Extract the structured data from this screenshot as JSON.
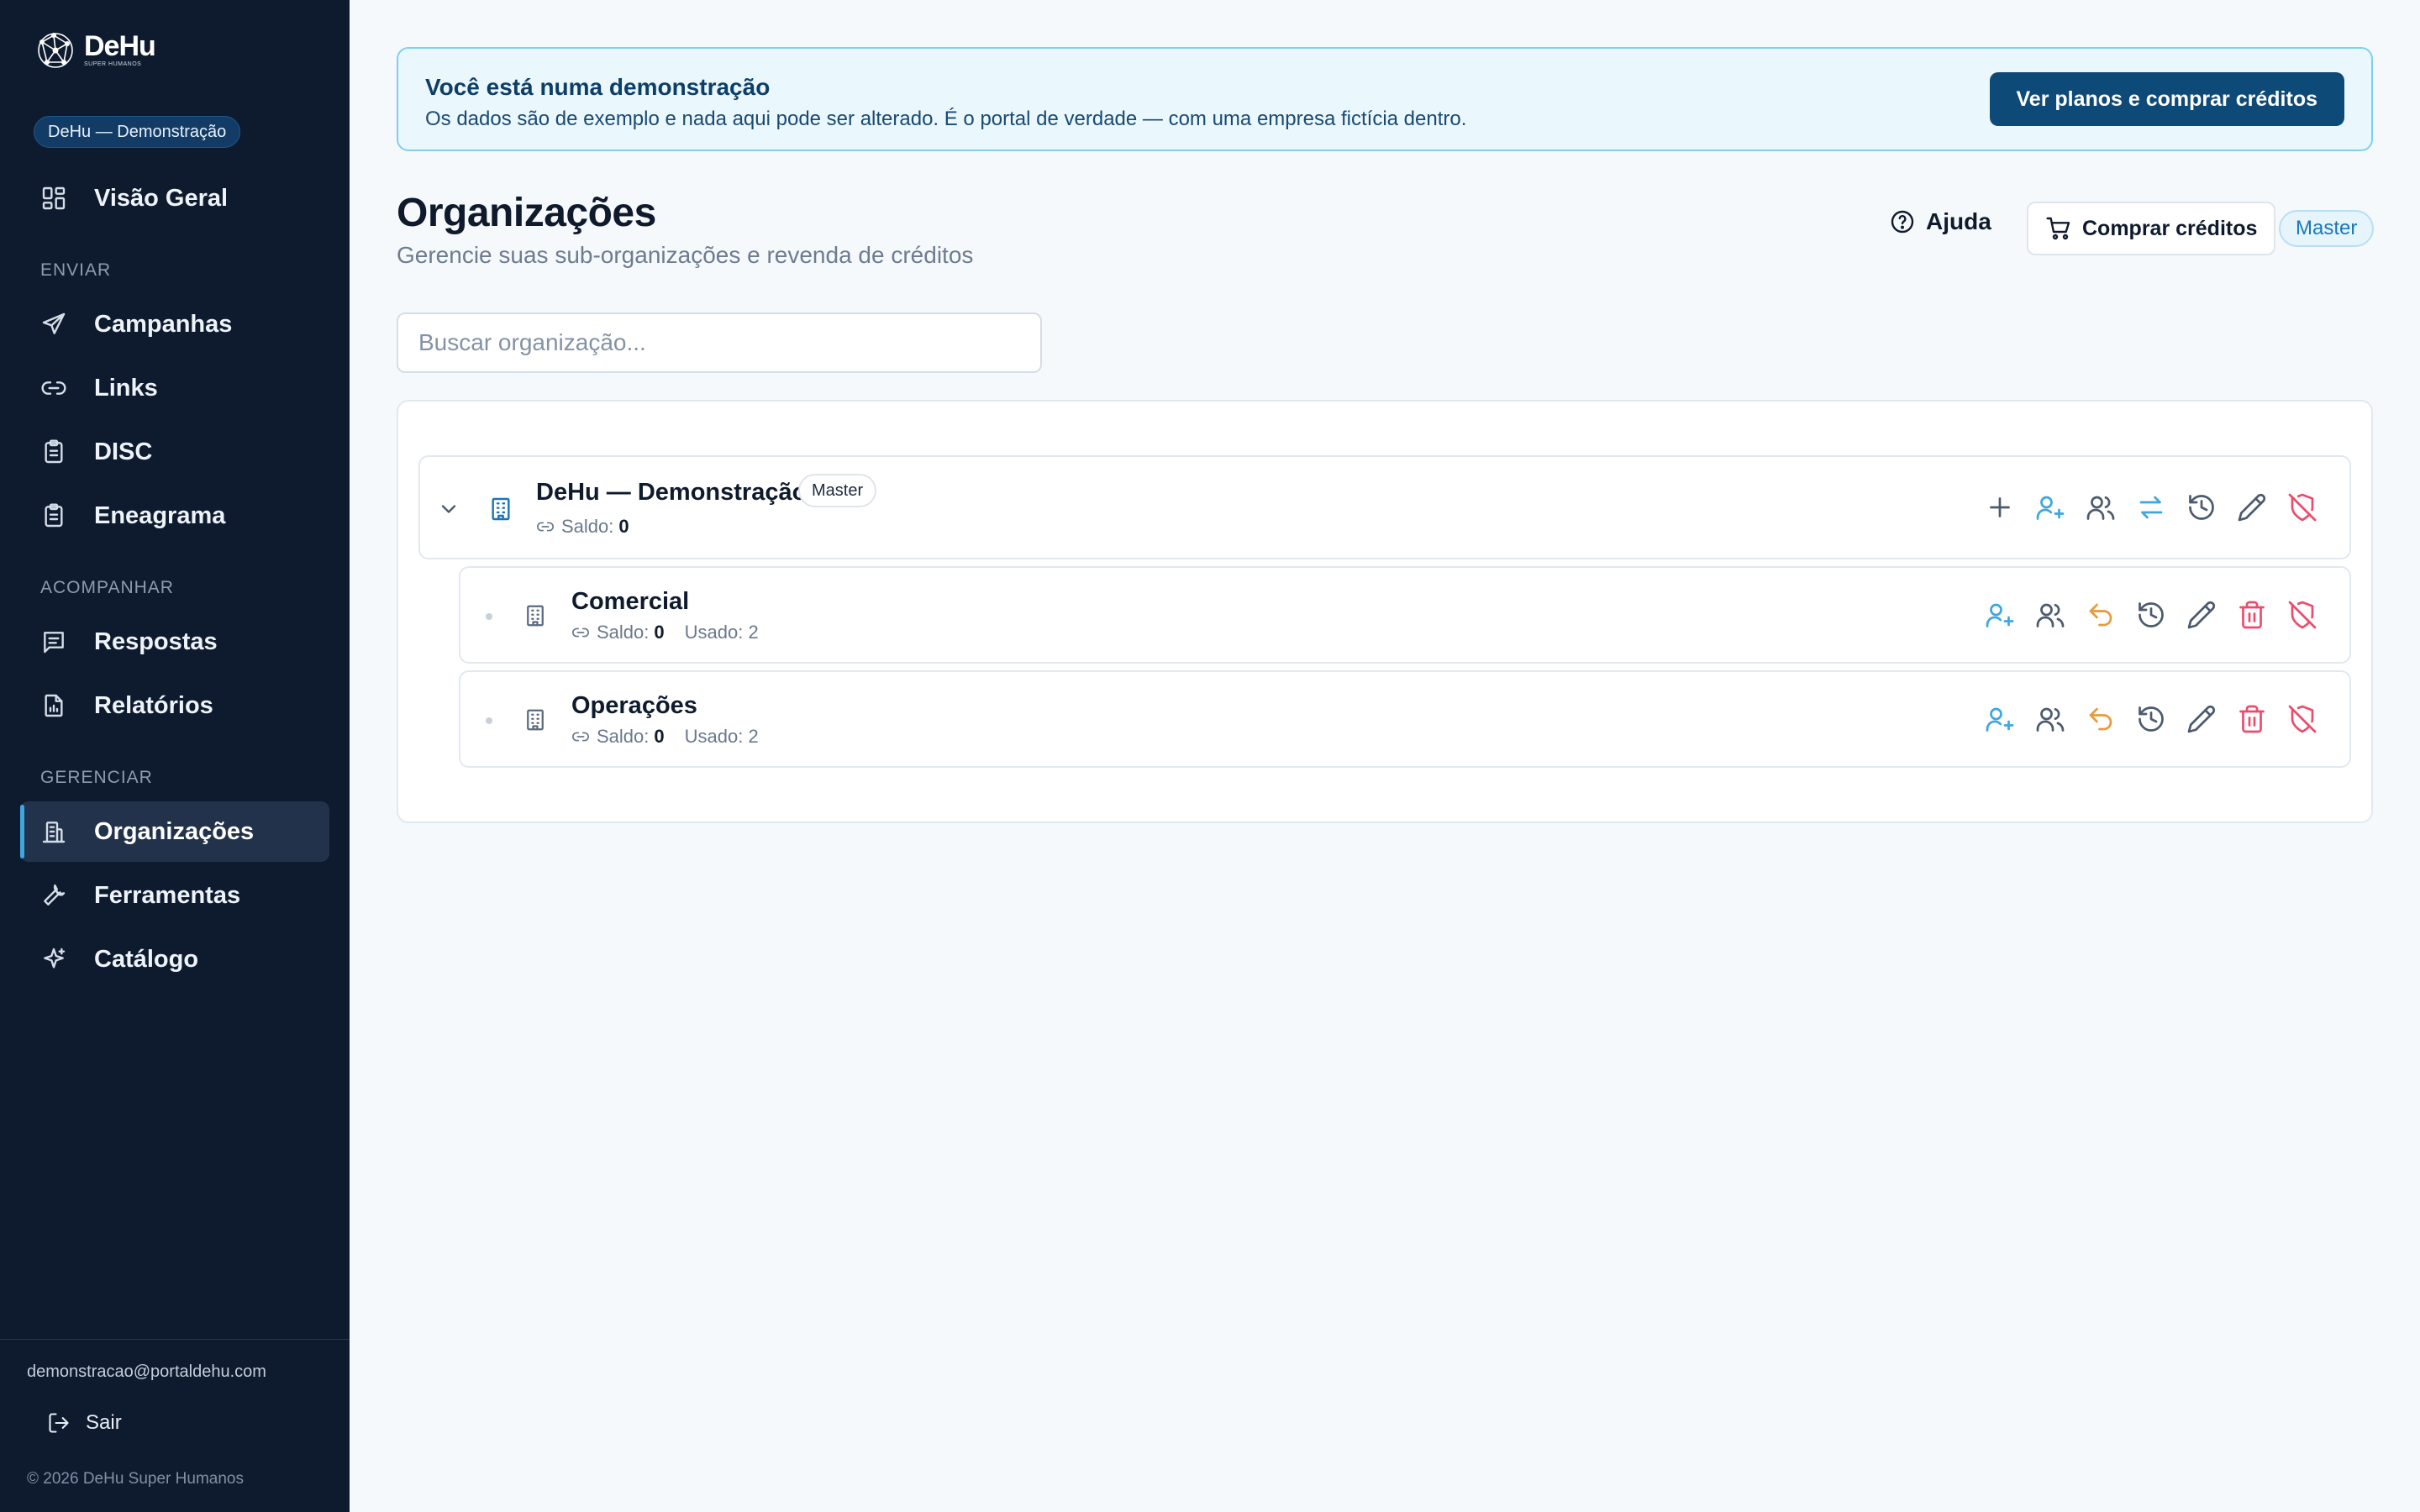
{
  "brand": {
    "name": "DeHu",
    "tagline": "SUPER HUMANOS"
  },
  "sidebar": {
    "org_pill": "DeHu — Demonstração",
    "overview": "Visão Geral",
    "sections": {
      "enviar": "ENVIAR",
      "acompanhar": "ACOMPANHAR",
      "gerenciar": "GERENCIAR"
    },
    "items": {
      "campanhas": "Campanhas",
      "links": "Links",
      "disc": "DISC",
      "eneagrama": "Eneagrama",
      "respostas": "Respostas",
      "relatorios": "Relatórios",
      "organizacoes": "Organizações",
      "ferramentas": "Ferramentas",
      "catalogo": "Catálogo"
    },
    "active": "organizacoes",
    "email": "demonstracao@portaldehu.com",
    "logout": "Sair",
    "copyright": "© 2026 DeHu Super Humanos"
  },
  "banner": {
    "title": "Você está numa demonstração",
    "text": "Os dados são de exemplo e nada aqui pode ser alterado. É o portal de verdade — com uma empresa fictícia dentro.",
    "button": "Ver planos e comprar créditos"
  },
  "header": {
    "title": "Organizações",
    "subtitle": "Gerencie suas sub-organizações e revenda de créditos",
    "help": "Ajuda",
    "buy": "Comprar créditos",
    "role_badge": "Master"
  },
  "search": {
    "placeholder": "Buscar organização..."
  },
  "organizations": {
    "root": {
      "name": "DeHu — Demonstração",
      "badge": "Master",
      "saldo_label": "Saldo:",
      "saldo": "0"
    },
    "children": [
      {
        "name": "Comercial",
        "saldo_label": "Saldo:",
        "saldo": "0",
        "usado": "Usado: 2"
      },
      {
        "name": "Operações",
        "saldo_label": "Saldo:",
        "saldo": "0",
        "usado": "Usado: 2"
      }
    ]
  },
  "colors": {
    "sidebar_bg": "#0e1b2e",
    "accent": "#3ea6e0",
    "primary_button": "#0d4a78",
    "danger": "#ec4c6b",
    "warning": "#e99a3a"
  },
  "icons": {
    "root_actions": [
      "plus-icon",
      "user-plus-icon",
      "users-icon",
      "transfer-icon",
      "history-icon",
      "edit-icon",
      "shield-off-icon"
    ],
    "child_actions": [
      "user-plus-icon",
      "users-icon",
      "undo-icon",
      "history-icon",
      "edit-icon",
      "trash-icon",
      "shield-off-icon"
    ]
  }
}
